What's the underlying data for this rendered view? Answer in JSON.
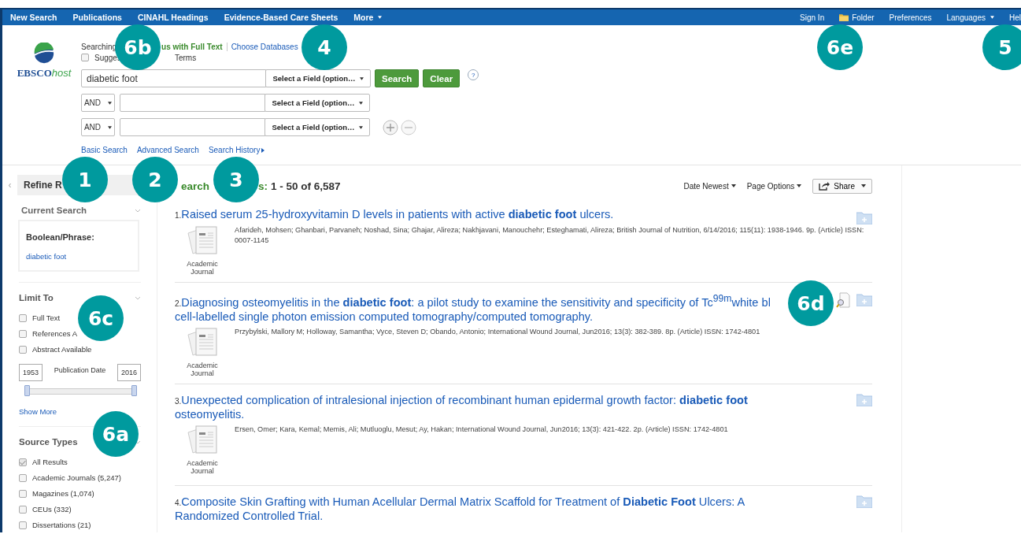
{
  "top_nav": {
    "left": [
      {
        "label": "New Search",
        "dropdown": false
      },
      {
        "label": "Publications",
        "dropdown": false
      },
      {
        "label": "CINAHL Headings",
        "dropdown": false
      },
      {
        "label": "Evidence-Based Care Sheets",
        "dropdown": false
      },
      {
        "label": "More",
        "dropdown": true
      }
    ],
    "right": [
      {
        "label": "Sign In",
        "dropdown": false,
        "kind": "text"
      },
      {
        "label": "Folder",
        "dropdown": false,
        "kind": "folder"
      },
      {
        "label": "Preferences",
        "dropdown": false,
        "kind": "text"
      },
      {
        "label": "Languages",
        "dropdown": true,
        "kind": "text"
      },
      {
        "label": "Hel",
        "dropdown": false,
        "kind": "text"
      }
    ]
  },
  "logo": {
    "brand": "EBSCO",
    "suffix": "host"
  },
  "search": {
    "searching_label": "Searching",
    "database": "us with Full Text",
    "choose_link": "Choose Databases",
    "suggest": {
      "label_start": "Sugges",
      "label_end": "Terms",
      "checked": false
    },
    "rows": [
      {
        "value": "diabetic foot",
        "field": "Select a Field (option…"
      },
      {
        "operator": "AND",
        "field": "Select a Field (option…"
      },
      {
        "operator": "AND",
        "field": "Select a Field (option…"
      }
    ],
    "buttons": [
      {
        "label": "Search"
      },
      {
        "label": "Clear"
      }
    ],
    "help": "?",
    "links": [
      {
        "label": "Basic Search",
        "arrow": false
      },
      {
        "label": "Advanced Search",
        "arrow": false
      },
      {
        "label": "Search History",
        "arrow": true
      }
    ]
  },
  "sidebar": {
    "collapse": "‹",
    "title": "Refine R",
    "current_search": {
      "title": "Current Search",
      "label": "Boolean/Phrase:",
      "query": "diabetic foot"
    },
    "limit_to": {
      "title": "Limit To",
      "options": [
        {
          "label": "Full Text",
          "checked": false
        },
        {
          "label": "References A",
          "checked": false
        },
        {
          "label": "Abstract Available",
          "checked": false
        }
      ],
      "date": {
        "from": "1953",
        "label": "Publication Date",
        "to": "2016"
      },
      "range_slider": {
        "level": 1
      }
    },
    "show_more": "Show More",
    "source_types": {
      "title": "Source Types",
      "options": [
        {
          "label": "All Results",
          "checked": true
        },
        {
          "label": "Academic Journals (5,247)",
          "checked": false
        },
        {
          "label": "Magazines (1,074)",
          "checked": false
        },
        {
          "label": "CEUs (332)",
          "checked": false
        },
        {
          "label": "Dissertations (21)",
          "checked": false
        }
      ]
    }
  },
  "results": {
    "heading_start": "earch",
    "heading_end": "s:",
    "count": "1 - 50 of 6,587",
    "toolbar": [
      {
        "label": "Date Newest",
        "kind": "menu"
      },
      {
        "label": "Page Options",
        "kind": "menu"
      },
      {
        "label": "Share",
        "kind": "button"
      }
    ],
    "items": [
      {
        "number": "1.",
        "title_lines": [
          "Raised serum 25-hydroxyvitamin D levels in patients with active **diabetic foot** ulcers."
        ],
        "meta": "Afarideh, Mohsen; Ghanbari, Parvaneh; Noshad, Sina; Ghajar, Alireza; Nakhjavani, Manouchehr; Esteghamati, Alireza; British Journal of Nutrition, 6/14/2016; 115(11): 1938-1946. 9p. (Article) ISSN: 0007-1145",
        "type": "Academic Journal",
        "preview": false
      },
      {
        "number": "2.",
        "title_lines": [
          "Diagnosing osteomyelitis in the **diabetic foot**: a pilot study to examine the sensitivity and specificity of Tc$^{99m}$white bl",
          "cell-labelled single photon emission computed tomography/computed tomography."
        ],
        "meta": "Przybylski, Mallory M; Holloway, Samantha; Vyce, Steven D; Obando, Antonio; International Wound Journal, Jun2016; 13(3): 382-389. 8p. (Article) ISSN: 1742-4801",
        "type": "Academic Journal",
        "preview": true
      },
      {
        "number": "3.",
        "title_lines": [
          "Unexpected complication of intralesional injection of recombinant human epidermal growth factor: **diabetic foot**",
          "osteomyelitis."
        ],
        "meta": "Ersen, Omer; Kara, Kemal; Memis, Ali; Mutluoglu, Mesut; Ay, Hakan; International Wound Journal, Jun2016; 13(3): 421-422. 2p. (Article) ISSN: 1742-4801",
        "type": "Academic Journal",
        "preview": false
      },
      {
        "number": "4.",
        "title_lines": [
          "Composite Skin Grafting with Human Acellular Dermal Matrix Scaffold for Treatment of **Diabetic Foot** Ulcers: A",
          "Randomized Controlled Trial."
        ],
        "preview": false
      }
    ]
  },
  "callouts": [
    {
      "label": "6b"
    },
    {
      "label": "4"
    },
    {
      "label": "6e"
    },
    {
      "label": "5"
    },
    {
      "label": "1"
    },
    {
      "label": "2"
    },
    {
      "label": "3"
    },
    {
      "label": "6c"
    },
    {
      "label": "6a"
    },
    {
      "label": "6d"
    }
  ]
}
